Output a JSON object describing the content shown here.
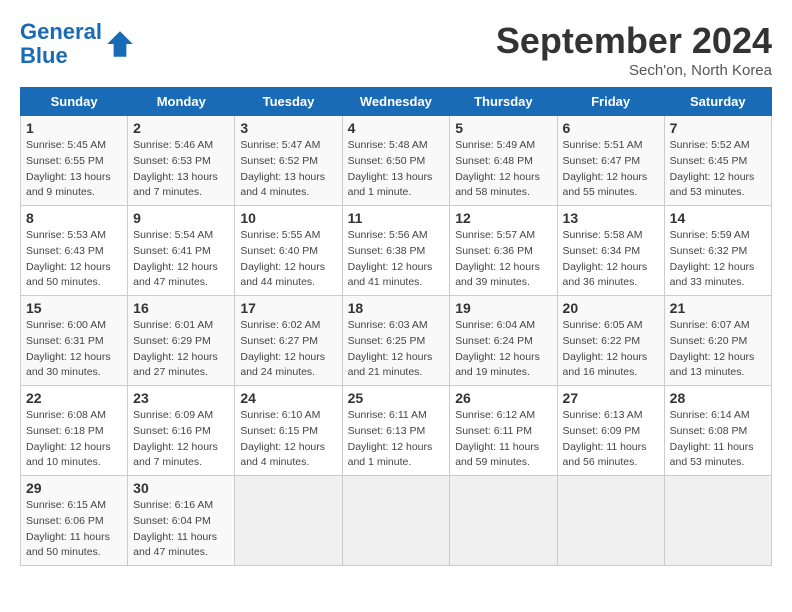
{
  "header": {
    "logo_line1": "General",
    "logo_line2": "Blue",
    "month": "September 2024",
    "location": "Sech'on, North Korea"
  },
  "weekdays": [
    "Sunday",
    "Monday",
    "Tuesday",
    "Wednesday",
    "Thursday",
    "Friday",
    "Saturday"
  ],
  "weeks": [
    [
      {
        "day": "1",
        "sunrise": "5:45 AM",
        "sunset": "6:55 PM",
        "daylight": "13 hours and 9 minutes."
      },
      {
        "day": "2",
        "sunrise": "5:46 AM",
        "sunset": "6:53 PM",
        "daylight": "13 hours and 7 minutes."
      },
      {
        "day": "3",
        "sunrise": "5:47 AM",
        "sunset": "6:52 PM",
        "daylight": "13 hours and 4 minutes."
      },
      {
        "day": "4",
        "sunrise": "5:48 AM",
        "sunset": "6:50 PM",
        "daylight": "13 hours and 1 minute."
      },
      {
        "day": "5",
        "sunrise": "5:49 AM",
        "sunset": "6:48 PM",
        "daylight": "12 hours and 58 minutes."
      },
      {
        "day": "6",
        "sunrise": "5:51 AM",
        "sunset": "6:47 PM",
        "daylight": "12 hours and 55 minutes."
      },
      {
        "day": "7",
        "sunrise": "5:52 AM",
        "sunset": "6:45 PM",
        "daylight": "12 hours and 53 minutes."
      }
    ],
    [
      {
        "day": "8",
        "sunrise": "5:53 AM",
        "sunset": "6:43 PM",
        "daylight": "12 hours and 50 minutes."
      },
      {
        "day": "9",
        "sunrise": "5:54 AM",
        "sunset": "6:41 PM",
        "daylight": "12 hours and 47 minutes."
      },
      {
        "day": "10",
        "sunrise": "5:55 AM",
        "sunset": "6:40 PM",
        "daylight": "12 hours and 44 minutes."
      },
      {
        "day": "11",
        "sunrise": "5:56 AM",
        "sunset": "6:38 PM",
        "daylight": "12 hours and 41 minutes."
      },
      {
        "day": "12",
        "sunrise": "5:57 AM",
        "sunset": "6:36 PM",
        "daylight": "12 hours and 39 minutes."
      },
      {
        "day": "13",
        "sunrise": "5:58 AM",
        "sunset": "6:34 PM",
        "daylight": "12 hours and 36 minutes."
      },
      {
        "day": "14",
        "sunrise": "5:59 AM",
        "sunset": "6:32 PM",
        "daylight": "12 hours and 33 minutes."
      }
    ],
    [
      {
        "day": "15",
        "sunrise": "6:00 AM",
        "sunset": "6:31 PM",
        "daylight": "12 hours and 30 minutes."
      },
      {
        "day": "16",
        "sunrise": "6:01 AM",
        "sunset": "6:29 PM",
        "daylight": "12 hours and 27 minutes."
      },
      {
        "day": "17",
        "sunrise": "6:02 AM",
        "sunset": "6:27 PM",
        "daylight": "12 hours and 24 minutes."
      },
      {
        "day": "18",
        "sunrise": "6:03 AM",
        "sunset": "6:25 PM",
        "daylight": "12 hours and 21 minutes."
      },
      {
        "day": "19",
        "sunrise": "6:04 AM",
        "sunset": "6:24 PM",
        "daylight": "12 hours and 19 minutes."
      },
      {
        "day": "20",
        "sunrise": "6:05 AM",
        "sunset": "6:22 PM",
        "daylight": "12 hours and 16 minutes."
      },
      {
        "day": "21",
        "sunrise": "6:07 AM",
        "sunset": "6:20 PM",
        "daylight": "12 hours and 13 minutes."
      }
    ],
    [
      {
        "day": "22",
        "sunrise": "6:08 AM",
        "sunset": "6:18 PM",
        "daylight": "12 hours and 10 minutes."
      },
      {
        "day": "23",
        "sunrise": "6:09 AM",
        "sunset": "6:16 PM",
        "daylight": "12 hours and 7 minutes."
      },
      {
        "day": "24",
        "sunrise": "6:10 AM",
        "sunset": "6:15 PM",
        "daylight": "12 hours and 4 minutes."
      },
      {
        "day": "25",
        "sunrise": "6:11 AM",
        "sunset": "6:13 PM",
        "daylight": "12 hours and 1 minute."
      },
      {
        "day": "26",
        "sunrise": "6:12 AM",
        "sunset": "6:11 PM",
        "daylight": "11 hours and 59 minutes."
      },
      {
        "day": "27",
        "sunrise": "6:13 AM",
        "sunset": "6:09 PM",
        "daylight": "11 hours and 56 minutes."
      },
      {
        "day": "28",
        "sunrise": "6:14 AM",
        "sunset": "6:08 PM",
        "daylight": "11 hours and 53 minutes."
      }
    ],
    [
      {
        "day": "29",
        "sunrise": "6:15 AM",
        "sunset": "6:06 PM",
        "daylight": "11 hours and 50 minutes."
      },
      {
        "day": "30",
        "sunrise": "6:16 AM",
        "sunset": "6:04 PM",
        "daylight": "11 hours and 47 minutes."
      },
      null,
      null,
      null,
      null,
      null
    ]
  ]
}
